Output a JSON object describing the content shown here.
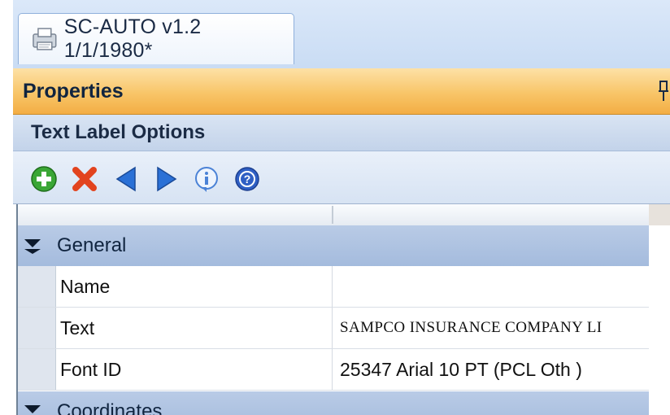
{
  "document_tab": {
    "label": "SC-AUTO v1.2 1/1/1980*",
    "icon": "document-icon"
  },
  "properties_panel": {
    "title": "Properties",
    "pin_icon": "pin-icon"
  },
  "section": {
    "title": "Text Label Options"
  },
  "toolbar": {
    "buttons": [
      {
        "icon": "add-icon",
        "color": "#3aa635"
      },
      {
        "icon": "delete-icon",
        "color": "#e2431e"
      },
      {
        "icon": "previous-icon",
        "color": "#2a70d6"
      },
      {
        "icon": "next-icon",
        "color": "#2a70d6"
      },
      {
        "icon": "info-icon",
        "color": "#4b82d6"
      },
      {
        "icon": "help-icon",
        "color": "#2f5fc4"
      }
    ]
  },
  "property_grid": {
    "groups": [
      {
        "label": "General",
        "rows": [
          {
            "name": "Name",
            "value": ""
          },
          {
            "name": "Text",
            "value": "SAMPCO INSURANCE COMPANY LI"
          },
          {
            "name": "Font ID",
            "value": "25347 Arial 10 PT (PCL Oth )"
          }
        ]
      },
      {
        "label": "Coordinates",
        "rows": []
      }
    ]
  },
  "colors": {
    "header_orange": "#f8c568",
    "group_blue": "#a9bfe0",
    "accent_blue": "#2a70d6"
  }
}
